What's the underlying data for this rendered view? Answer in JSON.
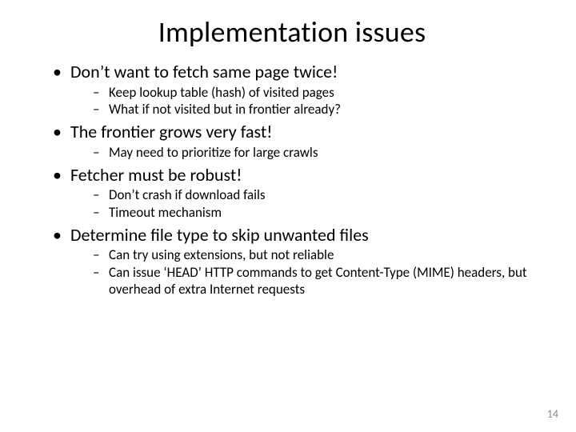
{
  "title": "Implementation issues",
  "bullets": [
    {
      "text": "Don’t want to fetch same page twice!",
      "sub": [
        "Keep lookup table (hash) of visited pages",
        "What if not visited but in frontier already?"
      ]
    },
    {
      "text": "The frontier grows very fast!",
      "sub": [
        "May need to prioritize for large crawls"
      ]
    },
    {
      "text": "Fetcher must be robust!",
      "sub": [
        "Don’t crash if download fails",
        "Timeout mechanism"
      ]
    },
    {
      "text": "Determine file type to skip unwanted files",
      "sub": [
        "Can try using extensions, but not reliable",
        "Can issue ‘HEAD’ HTTP commands to get Content-Type (MIME) headers, but overhead of extra Internet requests"
      ]
    }
  ],
  "page_number": "14"
}
